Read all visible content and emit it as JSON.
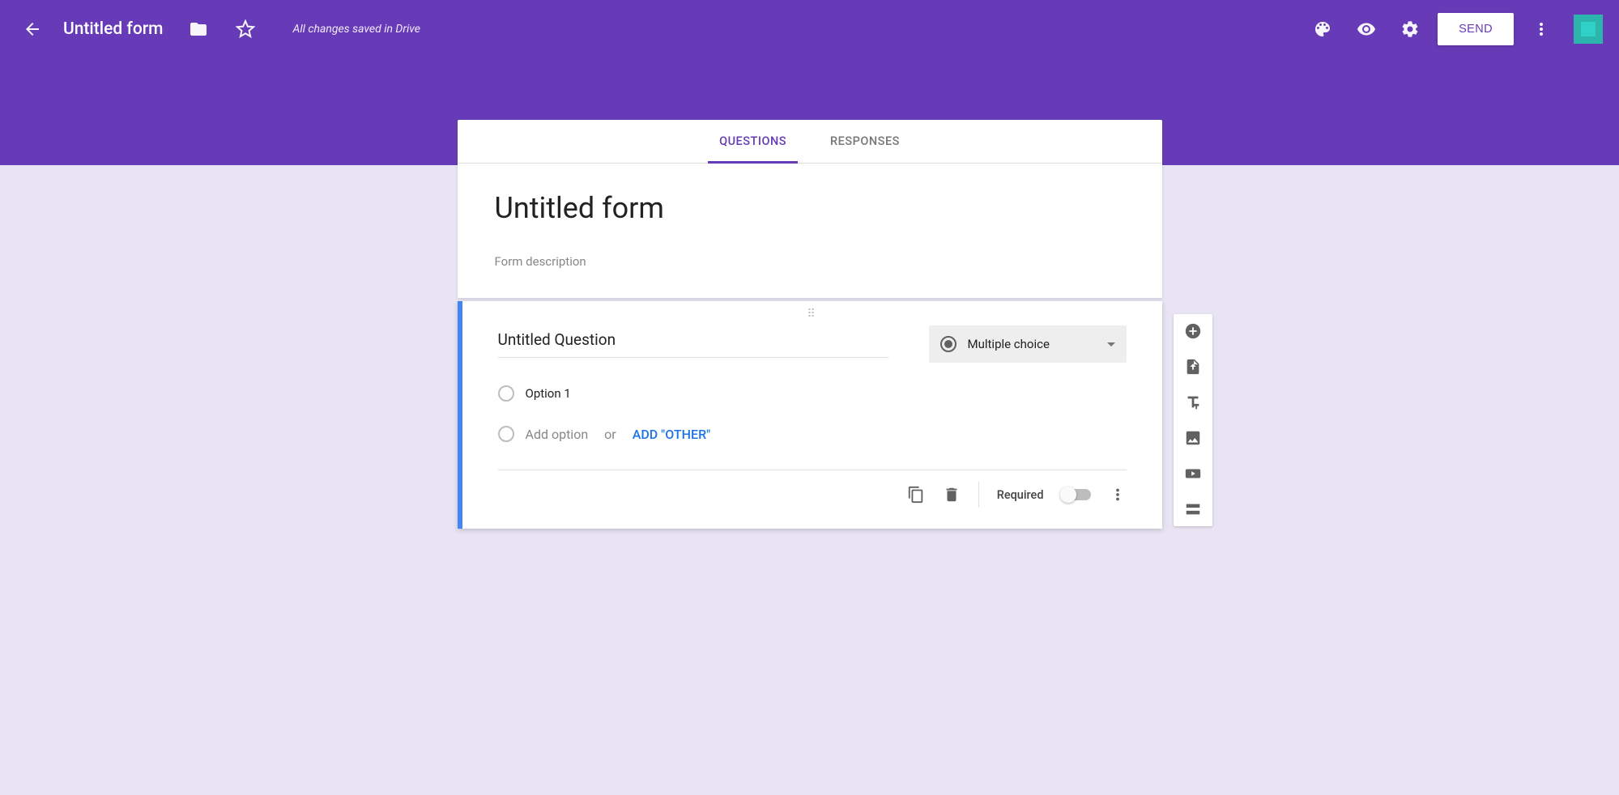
{
  "header": {
    "title": "Untitled form",
    "save_status": "All changes saved in Drive",
    "send_label": "SEND"
  },
  "tabs": {
    "questions": "QUESTIONS",
    "responses": "RESPONSES"
  },
  "form": {
    "title": "Untitled form",
    "description_placeholder": "Form description"
  },
  "question": {
    "title": "Untitled Question",
    "type_label": "Multiple choice",
    "options": [
      "Option 1"
    ],
    "add_option_label": "Add option",
    "or_label": "or",
    "add_other_label": "ADD \"OTHER\"",
    "required_label": "Required",
    "required_value": false
  }
}
